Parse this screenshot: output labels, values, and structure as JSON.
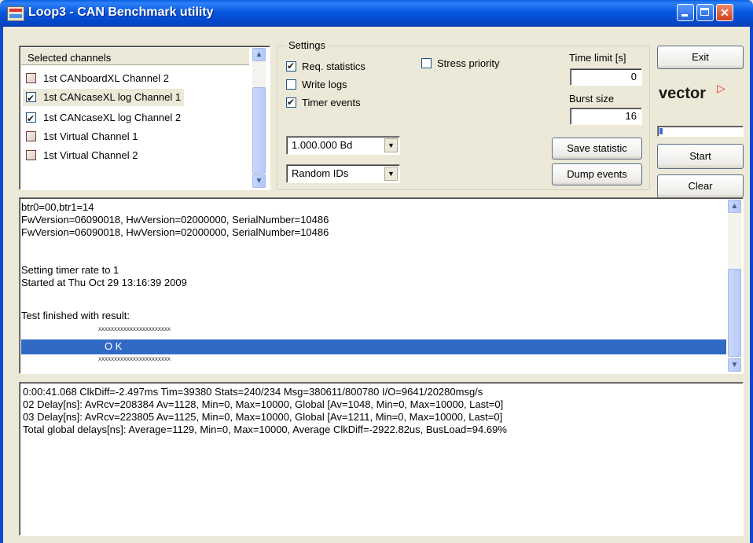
{
  "window": {
    "title": "Loop3 - CAN Benchmark utility"
  },
  "channels": {
    "header": "Selected channels",
    "items": [
      {
        "label": "1st CANboardXL Channel 2",
        "checked": false
      },
      {
        "label": "1st CANcaseXL log Channel 1",
        "checked": true
      },
      {
        "label": "1st CANcaseXL log Channel 2",
        "checked": true
      },
      {
        "label": "1st Virtual Channel 1",
        "checked": false
      },
      {
        "label": "1st Virtual Channel 2",
        "checked": false
      }
    ]
  },
  "settings": {
    "label": "Settings",
    "req_statistics": "Req. statistics",
    "write_logs": "Write logs",
    "timer_events": "Timer events",
    "stress_priority": "Stress priority",
    "baudrate": "1.000.000 Bd",
    "id_mode": "Random IDs",
    "time_limit_label": "Time limit [s]",
    "time_limit_value": "0",
    "burst_size_label": "Burst size",
    "burst_size_value": "16",
    "save_statistic": "Save statistic",
    "dump_events": "Dump events"
  },
  "buttons": {
    "exit": "Exit",
    "start": "Start",
    "clear": "Clear"
  },
  "logo": {
    "text": "vector",
    "color": "#e52a2a"
  },
  "progress": {
    "fraction": 0.03
  },
  "log": {
    "lines": [
      "btr0=00,btr1=14",
      "FwVersion=06090018, HwVersion=02000000, SerialNumber=10486",
      "FwVersion=06090018, HwVersion=02000000, SerialNumber=10486",
      "",
      "Setting timer rate to 1",
      "Started at Thu Oct 29 13:16:39 2009",
      "",
      "Test finished with result:"
    ],
    "stars": "xxxxxxxxxxxxxxxxxxxxxxx",
    "result": "O K"
  },
  "stats": {
    "lines": [
      "0:00:41.068 ClkDiff=-2.497ms Tim=39380 Stats=240/234 Msg=380611/800780 I/O=9641/20280msg/s",
      "02 Delay[ns]: AvRcv=208384 Av=1128, Min=0, Max=10000, Global [Av=1048, Min=0, Max=10000, Last=0]",
      "03 Delay[ns]: AvRcv=223805 Av=1125, Min=0, Max=10000, Global [Av=1211, Min=0, Max=10000, Last=0]",
      "Total global delays[ns]: Average=1129, Min=0, Max=10000, Average ClkDiff=-2922.82us, BusLoad=94.69%"
    ]
  }
}
